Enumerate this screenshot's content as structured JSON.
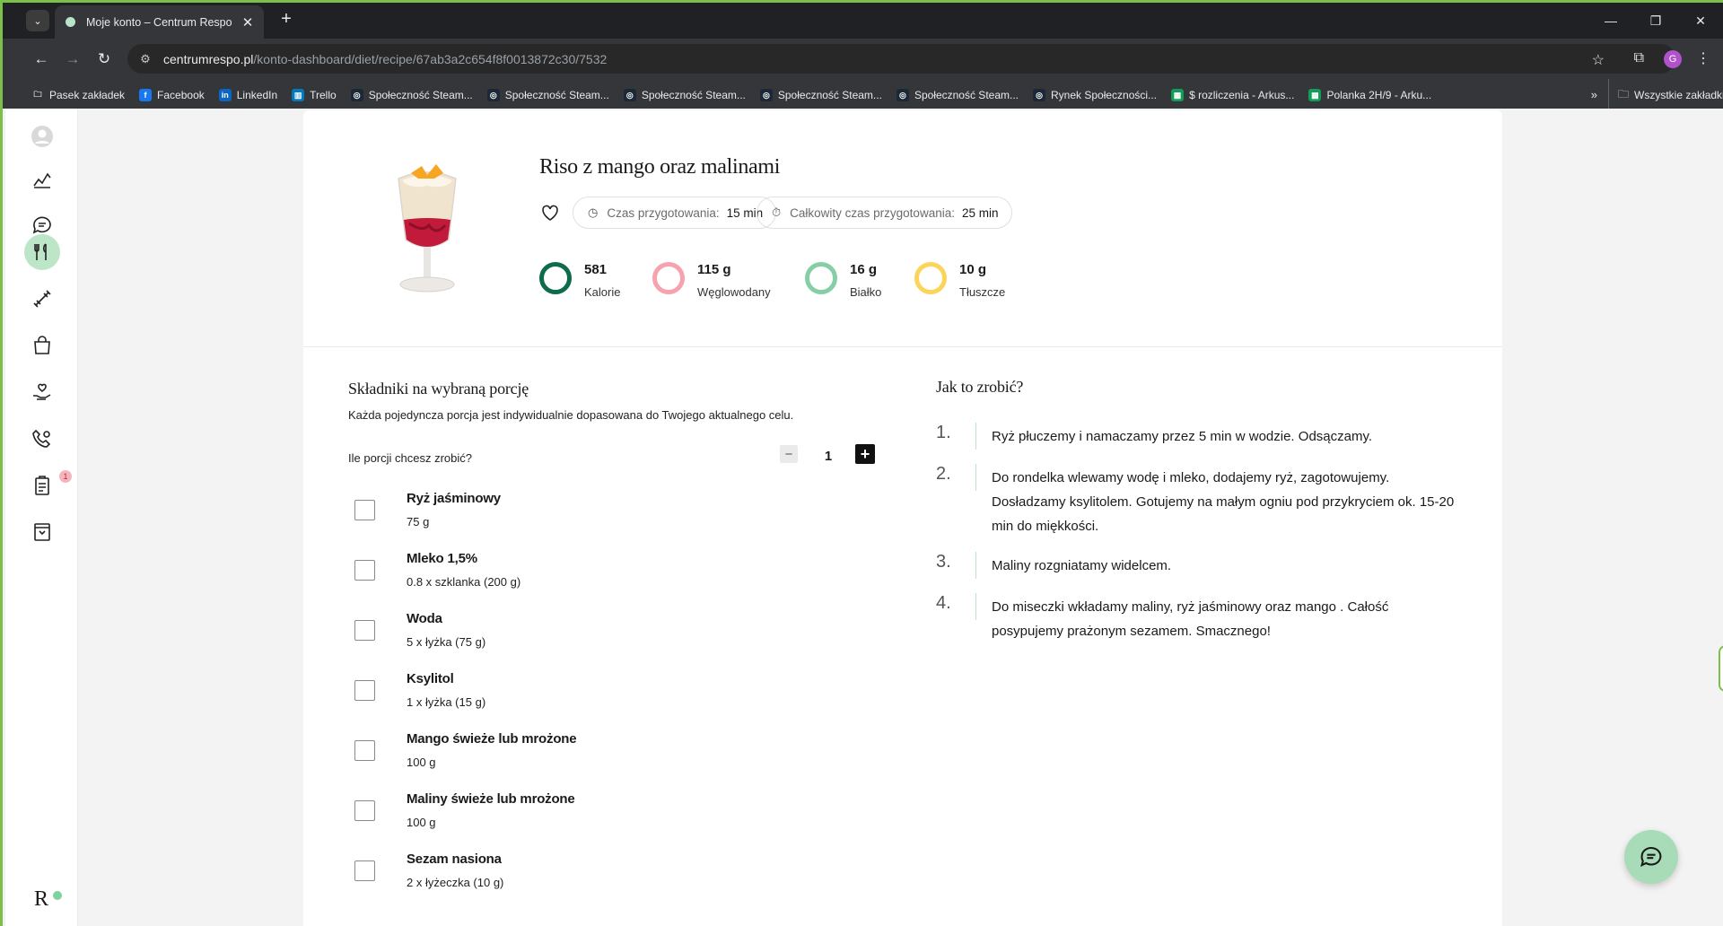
{
  "browser": {
    "tab_title": "Moje konto – Centrum Respo",
    "tab_close": "✕",
    "new_tab": "+",
    "url_host": "centrumrespo.pl",
    "url_path": "/konto-dashboard/diet/recipe/67ab3a2c654f8f0013872c30/7532",
    "profile_initial": "G",
    "bookmarks": [
      {
        "label": "Pasek zakładek",
        "icon": "folder-icon",
        "color": "#35363a"
      },
      {
        "label": "Facebook",
        "icon": "facebook-icon",
        "color": "#1877f2"
      },
      {
        "label": "LinkedIn",
        "icon": "linkedin-icon",
        "color": "#0a66c2"
      },
      {
        "label": "Trello",
        "icon": "trello-icon",
        "color": "#0079bf"
      },
      {
        "label": "Społeczność Steam...",
        "icon": "steam-icon",
        "color": "#1b2838"
      },
      {
        "label": "Społeczność Steam...",
        "icon": "steam-icon",
        "color": "#1b2838"
      },
      {
        "label": "Społeczność Steam...",
        "icon": "steam-icon",
        "color": "#1b2838"
      },
      {
        "label": "Społeczność Steam...",
        "icon": "steam-icon",
        "color": "#1b2838"
      },
      {
        "label": "Społeczność Steam...",
        "icon": "steam-icon",
        "color": "#1b2838"
      },
      {
        "label": "Rynek Społeczności...",
        "icon": "steam-icon",
        "color": "#1b2838"
      },
      {
        "label": "$ rozliczenia - Arkus...",
        "icon": "sheets-icon",
        "color": "#0f9d58"
      },
      {
        "label": "Polanka 2H/9 - Arku...",
        "icon": "sheets-icon",
        "color": "#0f9d58"
      }
    ],
    "bookmarks_overflow": "»",
    "bookmarks_all": "Wszystkie zakładki"
  },
  "sidebar": {
    "badge_count": "1",
    "logo": "R"
  },
  "recipe": {
    "title": "Riso z mango oraz malinami",
    "prep_label": "Czas przygotowania:",
    "prep_value": "15 min",
    "total_label": "Całkowity czas przygotowania:",
    "total_value": "25 min",
    "macros": [
      {
        "value": "581",
        "label": "Kalorie",
        "color": "#0e6b4e"
      },
      {
        "value": "115 g",
        "label": "Węglowodany",
        "color": "#f6a3ad"
      },
      {
        "value": "16 g",
        "label": "Białko",
        "color": "#86cfa6"
      },
      {
        "value": "10 g",
        "label": "Tłuszcze",
        "color": "#fcd45a"
      }
    ]
  },
  "ingredients": {
    "title": "Składniki na wybraną porcję",
    "subtitle": "Każda pojedyncza porcja jest indywidualnie dopasowana do Twojego aktualnego celu.",
    "portion_question": "Ile porcji chcesz zrobić?",
    "portion_minus": "−",
    "portion_value": "1",
    "portion_plus": "+",
    "items": [
      {
        "name": "Ryż jaśminowy",
        "amount": "75 g"
      },
      {
        "name": "Mleko 1,5%",
        "amount": "0.8 x szklanka (200 g)"
      },
      {
        "name": "Woda",
        "amount": "5 x łyżka (75 g)"
      },
      {
        "name": "Ksylitol",
        "amount": "1 x łyżka (15 g)"
      },
      {
        "name": "Mango świeże lub mrożone",
        "amount": "100 g"
      },
      {
        "name": "Maliny świeże lub mrożone",
        "amount": "100 g"
      },
      {
        "name": "Sezam nasiona",
        "amount": "2 x łyżeczka (10 g)"
      }
    ]
  },
  "steps": {
    "title": "Jak to zrobić?",
    "items": [
      {
        "num": "1.",
        "text": "Ryż płuczemy i namaczamy przez 5 min w wodzie. Odsączamy."
      },
      {
        "num": "2.",
        "text": "Do rondelka wlewamy wodę i mleko, dodajemy ryż, zagotowujemy. Dosładzamy ksylitolem. Gotujemy na małym ogniu pod przykryciem ok. 15-20 min do miękkości."
      },
      {
        "num": "3.",
        "text": "Maliny rozgniatamy widelcem."
      },
      {
        "num": "4.",
        "text": "Do miseczki wkładamy maliny, ryż jaśminowy oraz mango . Całość posypujemy prażonym sezamem. Smacznego!"
      }
    ]
  }
}
